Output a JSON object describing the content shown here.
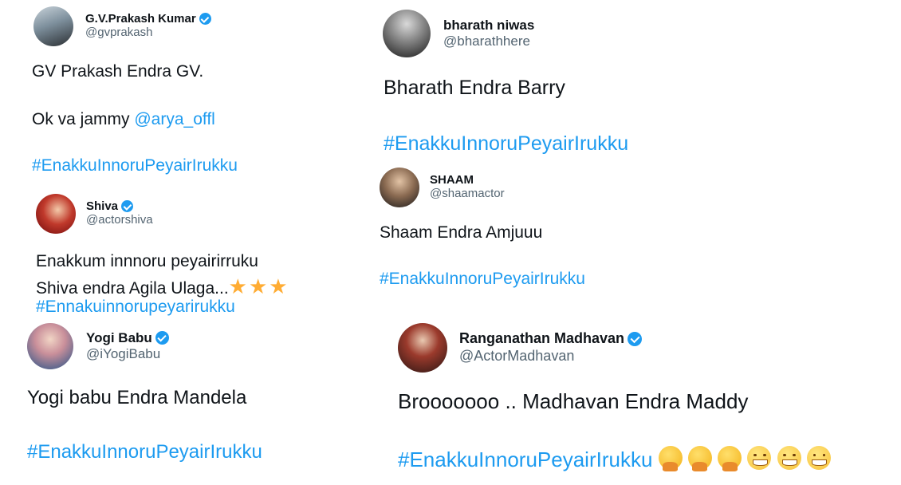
{
  "tweets": [
    {
      "name": "G.V.Prakash Kumar",
      "handle": "@gvprakash",
      "verified": true,
      "line1": "GV Prakash Endra GV.",
      "line2_prefix": "Ok va jammy ",
      "mention": "@arya_offl",
      "hashtag": "#EnakkuInnoruPeyairIrukku"
    },
    {
      "name": "bharath niwas",
      "handle": "@bharathhere",
      "verified": false,
      "line1": "Bharath Endra Barry",
      "hashtag": "#EnakkuInnoruPeyairIrukku"
    },
    {
      "name": "Shiva",
      "handle": "@actorshiva",
      "verified": true,
      "line1": "Enakkum innnoru peyairirruku",
      "line2": "Shiva endra Agila Ulaga...",
      "stars": "★★★",
      "hashtag": "#Ennakuinnorupeyarirukku"
    },
    {
      "name": "SHAAM",
      "handle": "@shaamactor",
      "verified": false,
      "line1": "Shaam Endra Amjuuu",
      "hashtag": "#EnakkuInnoruPeyairIrukku"
    },
    {
      "name": "Yogi Babu",
      "handle": "@iYogiBabu",
      "verified": true,
      "line1": "Yogi babu  Endra Mandela",
      "hashtag": "#EnakkuInnoruPeyairIrukku"
    },
    {
      "name": "Ranganathan Madhavan",
      "handle": "@ActorMadhavan",
      "verified": true,
      "line1": "Brooooooo .. Madhavan Endra Maddy",
      "hashtag": "#EnakkuInnoruPeyairIrukku",
      "emojis": [
        "hugging-face",
        "hugging-face",
        "hugging-face",
        "grinning-face",
        "grinning-face",
        "grinning-face"
      ]
    }
  ],
  "colors": {
    "link": "#1d9bf0",
    "text": "#0f1419",
    "handle": "#536471",
    "verified": "#1d9bf0"
  }
}
